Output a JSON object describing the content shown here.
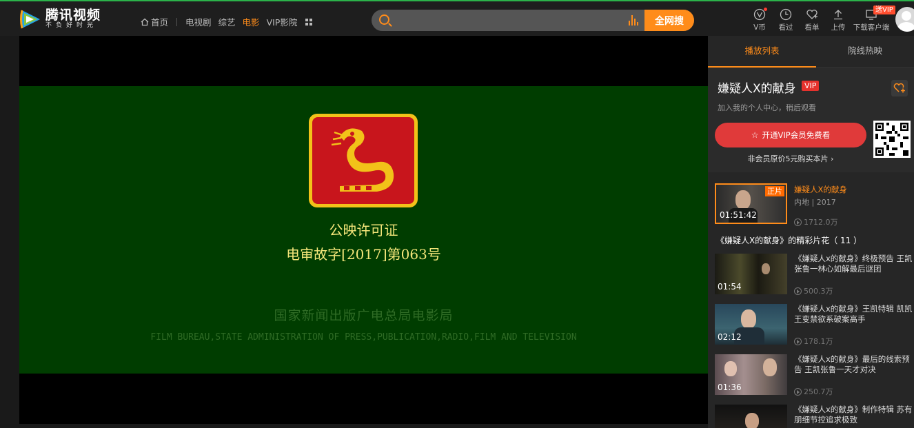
{
  "brand": {
    "name": "腾讯视频",
    "slogan": "不负好时光"
  },
  "nav": {
    "home": "首页",
    "items": [
      "电视剧",
      "综艺",
      "电影",
      "VIP影院"
    ],
    "active": "电影"
  },
  "search": {
    "placeholder": "",
    "button": "全网搜"
  },
  "tools": [
    {
      "label": "V币",
      "icon": "vcoin-icon"
    },
    {
      "label": "看过",
      "icon": "history-icon"
    },
    {
      "label": "看单",
      "icon": "watchlist-icon"
    },
    {
      "label": "上传",
      "icon": "upload-icon"
    },
    {
      "label": "下载客户端",
      "icon": "download-icon"
    }
  ],
  "send_vip": "送VIP",
  "video": {
    "license_line1": "公映许可证",
    "license_line2": "电审故字[2017]第063号",
    "bureau_cn": "国家新闻出版广电总局电影局",
    "bureau_en": "FILM BUREAU,STATE ADMINISTRATION OF PRESS,PUBLICATION,RADIO,FILM AND TELEVISION"
  },
  "sidebar": {
    "tabs": [
      "播放列表",
      "院线热映"
    ],
    "movie_title": "嫌疑人X的献身",
    "vip_badge": "VIP",
    "add_tip": "加入我的个人中心，稍后观看",
    "vip_button": "开通VIP会员免费看",
    "buy_tip": "非会员原价5元购买本片",
    "episode": {
      "tag": "正片",
      "duration": "01:51:42",
      "title": "嫌疑人X的献身",
      "meta": "内地 | 2017",
      "plays": "1712.0万"
    },
    "clips_title": "《嫌疑人X的献身》的精彩片花（ 11 ）",
    "clips": [
      {
        "title": "《嫌疑人x的献身》终极预告 王凯张鲁一林心如解最后谜团",
        "duration": "01:54",
        "plays": "500.3万"
      },
      {
        "title": "《嫌疑人x的献身》王凯特辑 凯凯王变禁欲系破案高手",
        "duration": "02:12",
        "plays": "178.1万"
      },
      {
        "title": "《嫌疑人x的献身》最后的线索预告 王凯张鲁一天才对决",
        "duration": "01:36",
        "plays": "250.7万"
      },
      {
        "title": "《嫌疑人x的献身》制作特辑 苏有朋细节控追求极致",
        "duration": "",
        "plays": ""
      }
    ]
  }
}
